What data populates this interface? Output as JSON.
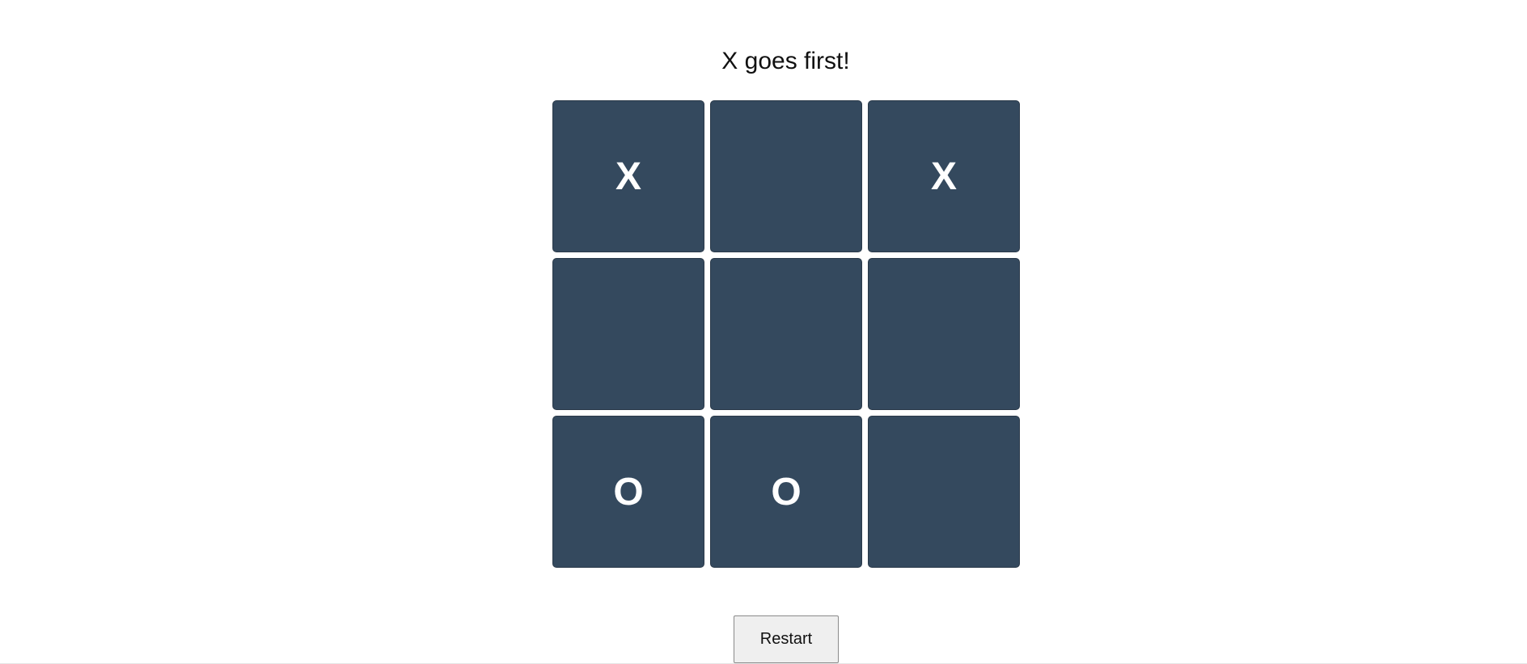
{
  "status_text": "X goes first!",
  "board": {
    "cells": [
      "X",
      "",
      "X",
      "",
      "",
      "",
      "O",
      "O",
      ""
    ]
  },
  "restart_label": "Restart",
  "colors": {
    "cell_background": "#34495e",
    "mark": "#ffffff",
    "page_background": "#ffffff"
  }
}
